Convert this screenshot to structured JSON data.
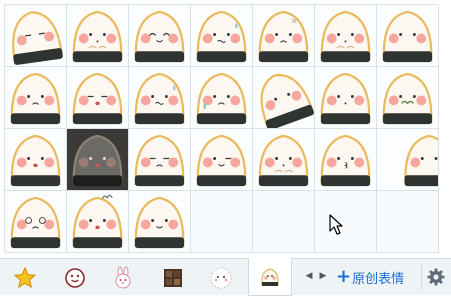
{
  "sticker_grid": {
    "columns": 7,
    "rows": 4,
    "cells": [
      {
        "face": "sleepy-tilt"
      },
      {
        "face": "blush-shy"
      },
      {
        "face": "smile-eyes-closed"
      },
      {
        "face": "sweat-worried"
      },
      {
        "face": "angry-cross"
      },
      {
        "face": "pout-side"
      },
      {
        "face": "blank-stare"
      },
      {
        "face": "frown"
      },
      {
        "face": "drool"
      },
      {
        "face": "nervous-sweat"
      },
      {
        "face": "wet-sad"
      },
      {
        "face": "tilt-side"
      },
      {
        "face": "peeking"
      },
      {
        "face": "mustache"
      },
      {
        "face": "happy-open"
      },
      {
        "face": "dark-glitch",
        "selected": true
      },
      {
        "face": "grumpy"
      },
      {
        "face": "wink"
      },
      {
        "face": "hands-up"
      },
      {
        "face": "kiss-blush"
      },
      {
        "face": "cut-off"
      },
      {
        "face": "dizzy-eyes"
      },
      {
        "face": "crazy-hair"
      },
      {
        "face": "calm-smile"
      },
      {
        "face": "empty"
      },
      {
        "face": "empty"
      },
      {
        "face": "empty"
      },
      {
        "face": "empty"
      }
    ]
  },
  "toolbar": {
    "tabs": [
      {
        "icon": "favorites-star-icon"
      },
      {
        "icon": "classic-face-icon"
      },
      {
        "icon": "bunny-sticker-icon"
      },
      {
        "icon": "photo-sticker-icon"
      },
      {
        "icon": "cartoon-face-icon"
      },
      {
        "icon": "dumpling-face-icon",
        "active": true
      }
    ],
    "add_custom_label": "原创表情",
    "add_custom_plus": "+",
    "prev_arrow": "◀",
    "next_arrow": "▶",
    "settings_icon": "gear-icon"
  },
  "colors": {
    "accent": "#1f6fd1",
    "grid_line": "#d6e3ea",
    "toolbar_bg": "#eef3f6"
  }
}
